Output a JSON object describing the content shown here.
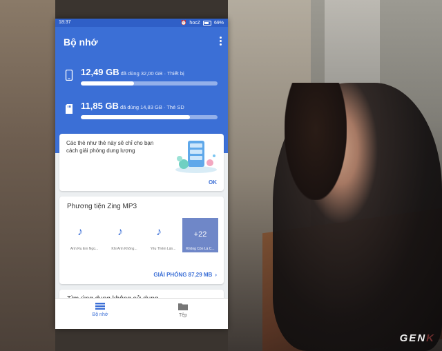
{
  "status": {
    "time": "18:37",
    "carrier": "hocZ",
    "battery": "69%"
  },
  "header": {
    "title": "Bộ nhớ"
  },
  "device_storage": {
    "used": "12,49 GB",
    "detail": "đã dùng 32,00 GB · Thiết bị",
    "fill_fraction": 0.39
  },
  "sd_storage": {
    "used": "11,85 GB",
    "detail": "đã dùng 14,83 GB · Thẻ SD",
    "fill_fraction": 0.8
  },
  "tip_card": {
    "message": "Các thẻ như thẻ này sẽ chỉ cho bạn cách giải phóng dung lượng",
    "ok": "OK"
  },
  "zing_card": {
    "title": "Phương tiện Zing MP3",
    "tiles": [
      {
        "label": "Anh Ru Em Ngủ..."
      },
      {
        "label": "Khi Anh Không..."
      },
      {
        "label": "Yêu Thêm Lần..."
      }
    ],
    "more": {
      "count": "+22",
      "label": "Không Còn Là C..."
    },
    "free_button": "GIẢI PHÓNG 87,29 MB"
  },
  "unused_card": {
    "title": "Tìm ứng dụng không sử dụng"
  },
  "nav": {
    "storage": "Bộ nhớ",
    "files": "Tệp"
  },
  "watermark": {
    "text": "GEN",
    "k": "K"
  },
  "colors": {
    "brand_blue": "#3b6fd6",
    "header_blue": "#3b6fd6",
    "status_blue": "#2f5fc7"
  }
}
